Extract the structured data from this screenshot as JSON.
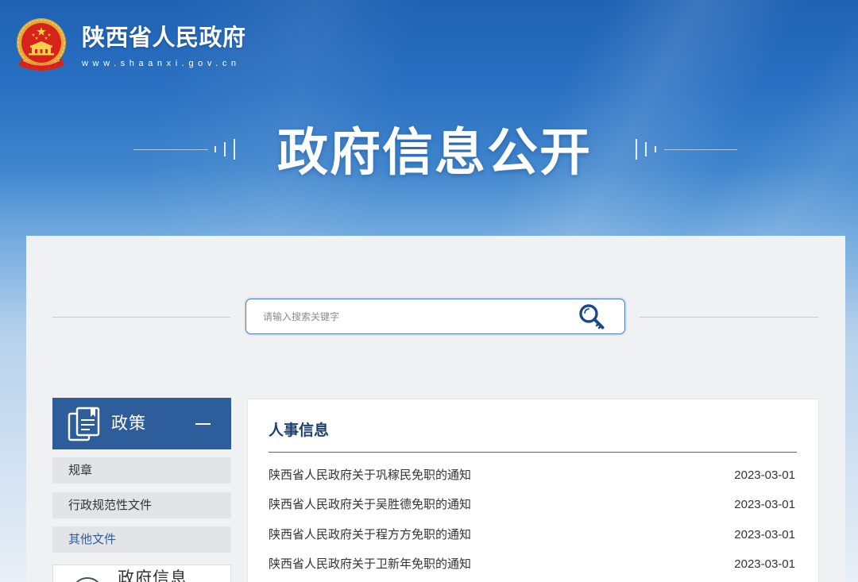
{
  "site": {
    "name": "陕西省人民政府",
    "url": "www.shaanxi.gov.cn",
    "emblem_icon": "national-emblem-icon"
  },
  "banner": {
    "title": "政府信息公开"
  },
  "search": {
    "placeholder": "请输入搜索关键字",
    "value": "",
    "icon": "search-key-icon"
  },
  "sidebar": {
    "sections": [
      {
        "label": "政策",
        "icon": "documents-icon",
        "toggle_icon": "minus-icon",
        "expanded": true,
        "items": [
          {
            "label": "规章",
            "active": false
          },
          {
            "label": "行政规范性文件",
            "active": false
          },
          {
            "label": "其他文件",
            "active": true
          }
        ]
      },
      {
        "label": "政府信息",
        "icon": "circle-icon"
      }
    ]
  },
  "content": {
    "title": "人事信息",
    "items": [
      {
        "title": "陕西省人民政府关于巩稼民免职的通知",
        "date": "2023-03-01"
      },
      {
        "title": "陕西省人民政府关于吴胜德免职的通知",
        "date": "2023-03-01"
      },
      {
        "title": "陕西省人民政府关于程方方免职的通知",
        "date": "2023-03-01"
      },
      {
        "title": "陕西省人民政府关于卫新年免职的通知",
        "date": "2023-03-01"
      }
    ]
  },
  "colors": {
    "header_blue": "#2a6cbc",
    "accent": "#2e5d9b",
    "title_navy": "#1e3e6d",
    "panel_bg": "#f0f1f3",
    "item_bg": "#e2e4e8",
    "text": "#333333",
    "emblem_red": "#d8231a",
    "emblem_gold": "#f3c54a"
  }
}
